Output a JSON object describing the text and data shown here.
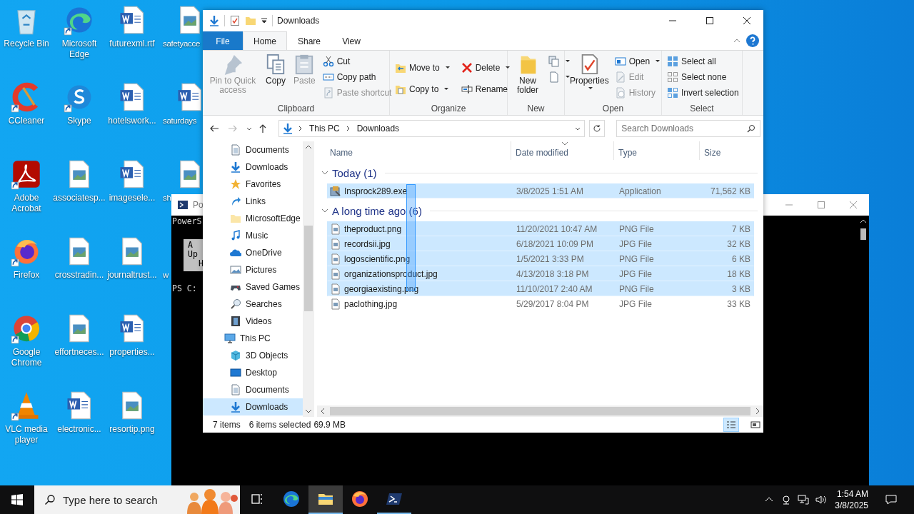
{
  "desktop_icons": [
    {
      "label": "Recycle Bin",
      "kind": "recycle",
      "shortcut": false
    },
    {
      "label": "CCleaner",
      "kind": "ccleaner",
      "shortcut": true
    },
    {
      "label": "Adobe Acrobat",
      "kind": "acrobat",
      "shortcut": true
    },
    {
      "label": "Firefox",
      "kind": "firefox",
      "shortcut": true
    },
    {
      "label": "Google Chrome",
      "kind": "chrome",
      "shortcut": true
    },
    {
      "label": "VLC media player",
      "kind": "vlc",
      "shortcut": true
    },
    {
      "label": "Microsoft Edge",
      "kind": "edge",
      "shortcut": true
    },
    {
      "label": "Skype",
      "kind": "skype",
      "shortcut": true
    },
    {
      "label": "associatesp...",
      "kind": "image",
      "shortcut": false
    },
    {
      "label": "crosstradin...",
      "kind": "image",
      "shortcut": false
    },
    {
      "label": "effortneces...",
      "kind": "image",
      "shortcut": false
    },
    {
      "label": "electronic...",
      "kind": "word",
      "shortcut": false
    },
    {
      "label": "futurexml.rtf",
      "kind": "word",
      "shortcut": false
    },
    {
      "label": "hotelswork...",
      "kind": "word",
      "shortcut": false
    },
    {
      "label": "imagesele...",
      "kind": "word",
      "shortcut": false
    },
    {
      "label": "journaltrust...",
      "kind": "image",
      "shortcut": false
    },
    {
      "label": "properties...",
      "kind": "word",
      "shortcut": false
    },
    {
      "label": "resortip.png",
      "kind": "image",
      "shortcut": false
    },
    {
      "label": "safetyacce",
      "kind": "image",
      "shortcut": false
    },
    {
      "label": "saturdays",
      "kind": "word",
      "shortcut": false
    },
    {
      "label": "sh",
      "kind": "image",
      "shortcut": false
    },
    {
      "label": "w",
      "kind": "covered"
    }
  ],
  "powershell": {
    "title": "Po",
    "lines": [
      {
        "text": "PowerS",
        "kind": "plain"
      },
      {
        "text": "A",
        "kind": "boxed"
      },
      {
        "text": "Up",
        "kind": "boxed"
      },
      {
        "text": "H",
        "kind": "boxed-indent"
      },
      {
        "text": "PS C:",
        "kind": "prompt"
      }
    ]
  },
  "explorer": {
    "title": "Downloads",
    "ribbon_tabs": [
      {
        "label": "File",
        "kind": "file",
        "selected": false
      },
      {
        "label": "Home",
        "kind": "normal",
        "selected": true
      },
      {
        "label": "Share",
        "kind": "normal",
        "selected": false
      },
      {
        "label": "View",
        "kind": "normal",
        "selected": false
      }
    ],
    "ribbon_groups": [
      {
        "label": "Clipboard",
        "columns": [
          [
            {
              "label": "Pin to Quick access",
              "kind": "pin",
              "disabled": true,
              "dropdown": false
            }
          ],
          [
            {
              "label": "Copy",
              "kind": "copy",
              "disabled": false,
              "dropdown": false
            }
          ],
          [
            {
              "label": "Paste",
              "kind": "paste",
              "disabled": true,
              "dropdown": false
            }
          ],
          [
            {
              "label": "Cut",
              "kind": "cut",
              "disabled": false,
              "dropdown": false
            },
            {
              "label": "Copy path",
              "kind": "copypath",
              "disabled": false,
              "dropdown": false
            },
            {
              "label": "Paste shortcut",
              "kind": "pasteshortcut",
              "disabled": true,
              "dropdown": false
            }
          ]
        ]
      },
      {
        "label": "Organize",
        "columns": [
          [
            {
              "label": "Move to",
              "kind": "moveto",
              "disabled": false,
              "dropdown": true
            },
            {
              "label": "Copy to",
              "kind": "copyto",
              "disabled": false,
              "dropdown": true
            }
          ],
          [
            {
              "label": "Delete",
              "kind": "delete",
              "disabled": false,
              "dropdown": true
            },
            {
              "label": "Rename",
              "kind": "rename",
              "disabled": false,
              "dropdown": false
            }
          ]
        ]
      },
      {
        "label": "New",
        "columns": [
          [
            {
              "label": "New folder",
              "kind": "newfolder",
              "disabled": false,
              "dropdown": false
            }
          ],
          [
            {
              "kind": "newitem",
              "dropdown": true
            },
            {
              "kind": "easyaccess",
              "dropdown": true
            }
          ]
        ]
      },
      {
        "label": "Open",
        "columns": [
          [
            {
              "label": "Properties",
              "kind": "properties",
              "disabled": false,
              "dropdown": true
            }
          ],
          [
            {
              "label": "Open",
              "kind": "open",
              "disabled": false,
              "dropdown": true
            },
            {
              "label": "Edit",
              "kind": "edit",
              "disabled": true,
              "dropdown": false
            },
            {
              "label": "History",
              "kind": "history",
              "disabled": true,
              "dropdown": false
            }
          ]
        ]
      },
      {
        "label": "Select",
        "columns": [
          [
            {
              "label": "Select all",
              "kind": "selectall",
              "disabled": false,
              "dropdown": false
            },
            {
              "label": "Select none",
              "kind": "selectnone",
              "disabled": false,
              "dropdown": false
            },
            {
              "label": "Invert selection",
              "kind": "invert",
              "disabled": false,
              "dropdown": false
            }
          ]
        ]
      }
    ],
    "path": [
      "This PC",
      "Downloads"
    ],
    "search": {
      "placeholder": "Search Downloads"
    },
    "nav_items": [
      {
        "label": "Documents",
        "kind": "documents",
        "selected": false
      },
      {
        "label": "Downloads",
        "kind": "downloads",
        "selected": false
      },
      {
        "label": "Favorites",
        "kind": "favorites",
        "selected": false
      },
      {
        "label": "Links",
        "kind": "links",
        "selected": false
      },
      {
        "label": "MicrosoftEdge",
        "kind": "folder",
        "selected": false
      },
      {
        "label": "Music",
        "kind": "music",
        "selected": false
      },
      {
        "label": "OneDrive",
        "kind": "onedrive",
        "selected": false
      },
      {
        "label": "Pictures",
        "kind": "pictures",
        "selected": false
      },
      {
        "label": "Saved Games",
        "kind": "games",
        "selected": false
      },
      {
        "label": "Searches",
        "kind": "searches",
        "selected": false
      },
      {
        "label": "Videos",
        "kind": "videos",
        "selected": false
      },
      {
        "label": "This PC",
        "kind": "pc",
        "selected": false,
        "children": [
          {
            "label": "3D Objects",
            "kind": "objects",
            "selected": false
          },
          {
            "label": "Desktop",
            "kind": "desktop",
            "selected": false
          },
          {
            "label": "Documents",
            "kind": "documents",
            "selected": false
          },
          {
            "label": "Downloads",
            "kind": "downloads",
            "selected": true
          }
        ]
      }
    ],
    "columns": [
      {
        "label": "Name",
        "sorted": false
      },
      {
        "label": "Date modified",
        "sorted": true
      },
      {
        "label": "Type",
        "sorted": false
      },
      {
        "label": "Size",
        "sorted": false
      }
    ],
    "groups": [
      {
        "label": "Today (1)",
        "expanded": true,
        "rows": [
          {
            "name": "Insprock289.exe",
            "date": "3/8/2025 1:51 AM",
            "type": "Application",
            "size": "71,562 KB",
            "kind": "exe",
            "selected": true
          }
        ]
      },
      {
        "label": "A long time ago (6)",
        "expanded": true,
        "rows": [
          {
            "name": "theproduct.png",
            "date": "11/20/2021 10:47 AM",
            "type": "PNG File",
            "size": "7 KB",
            "kind": "image",
            "selected": true
          },
          {
            "name": "recordsii.jpg",
            "date": "6/18/2021 10:09 PM",
            "type": "JPG File",
            "size": "32 KB",
            "kind": "image",
            "selected": true
          },
          {
            "name": "logoscientific.png",
            "date": "1/5/2021 3:33 PM",
            "type": "PNG File",
            "size": "6 KB",
            "kind": "image",
            "selected": true
          },
          {
            "name": "organizationsproduct.jpg",
            "date": "4/13/2018 3:18 PM",
            "type": "JPG File",
            "size": "18 KB",
            "kind": "image",
            "selected": true
          },
          {
            "name": "georgiaexisting.png",
            "date": "11/10/2017 2:40 AM",
            "type": "PNG File",
            "size": "3 KB",
            "kind": "image",
            "selected": true
          },
          {
            "name": "paclothing.jpg",
            "date": "5/29/2017 8:04 PM",
            "type": "JPG File",
            "size": "33 KB",
            "kind": "image",
            "selected": false
          }
        ]
      }
    ],
    "status": {
      "count": "7 items",
      "selected": "6 items selected",
      "size": "69.9 MB"
    },
    "views": [
      {
        "kind": "details",
        "selected": true
      },
      {
        "kind": "tiles",
        "selected": false
      }
    ]
  },
  "taskbar": {
    "search": {
      "placeholder": "Type here to search"
    },
    "apps": [
      {
        "kind": "taskview",
        "running": false,
        "active": false
      },
      {
        "kind": "edge",
        "running": false,
        "active": false
      },
      {
        "kind": "explorer",
        "running": true,
        "active": true
      },
      {
        "kind": "firefox",
        "running": false,
        "active": false
      },
      {
        "kind": "powershell",
        "running": true,
        "active": false
      }
    ],
    "time": "1:54 AM",
    "date": "3/8/2025"
  }
}
